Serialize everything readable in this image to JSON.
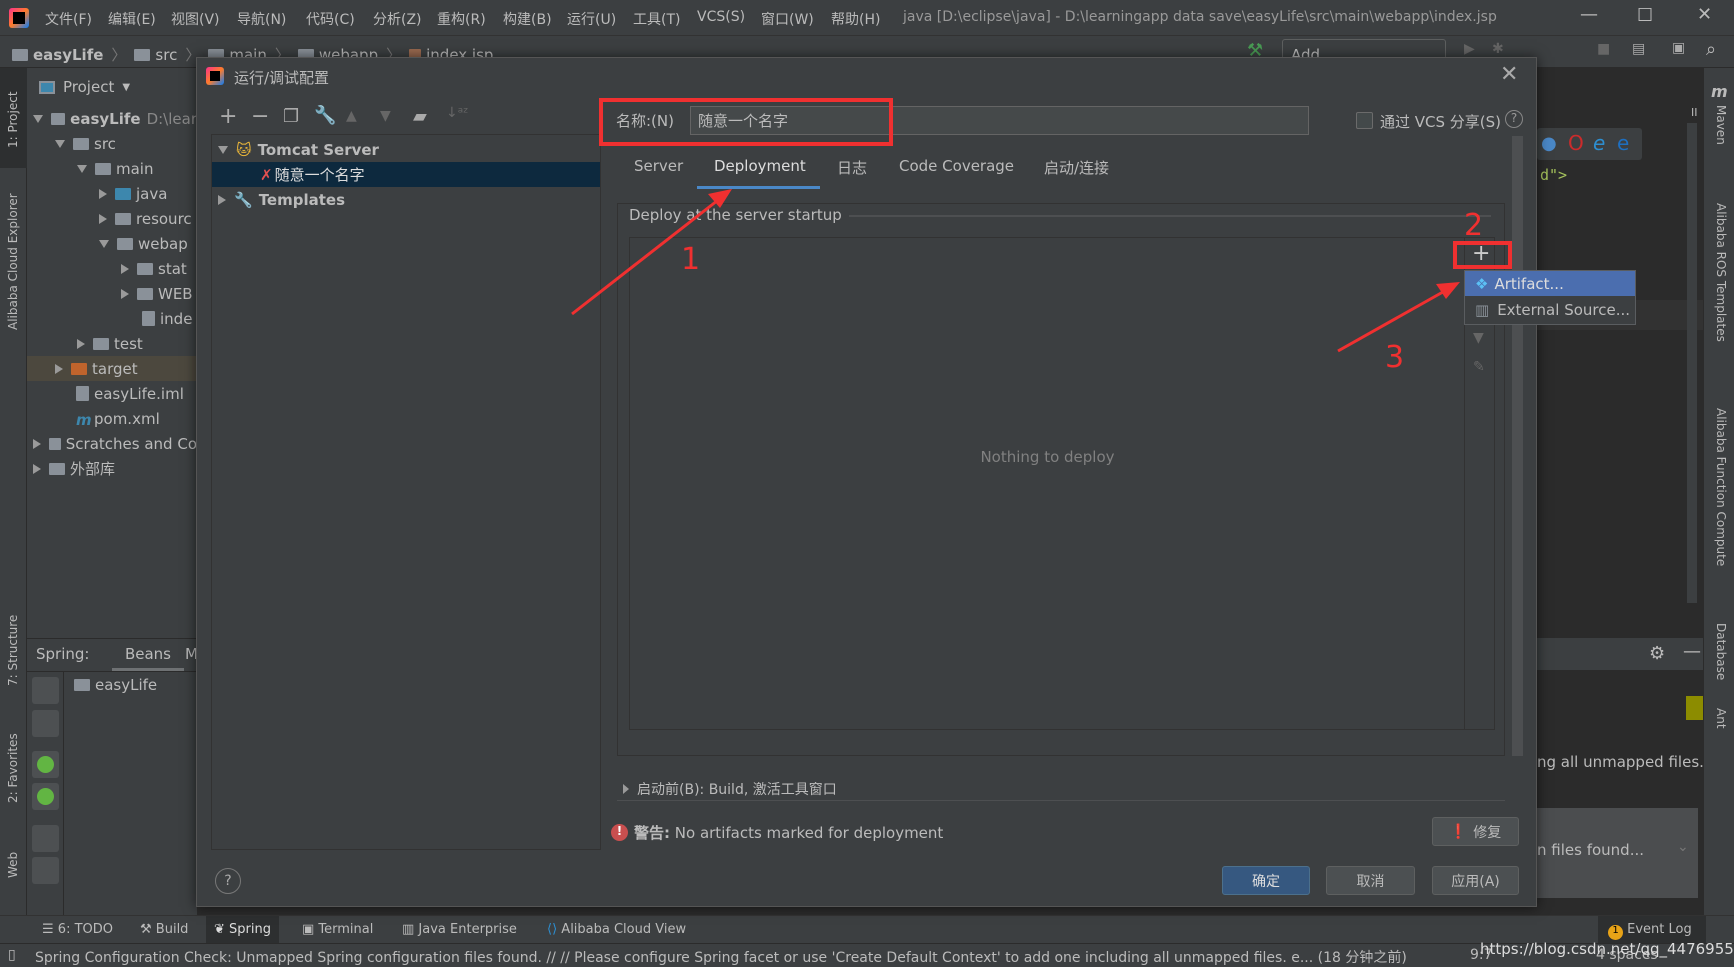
{
  "menubar": {
    "items": [
      "文件(F)",
      "编辑(E)",
      "视图(V)",
      "导航(N)",
      "代码(C)",
      "分析(Z)",
      "重构(R)",
      "构建(B)",
      "运行(U)",
      "工具(T)",
      "VCS(S)",
      "窗口(W)",
      "帮助(H)"
    ],
    "window_title": "java [D:\\eclipse\\java] - D:\\learningapp data save\\easyLife\\src\\main\\webapp\\index.jsp"
  },
  "breadcrumb": [
    "easyLife",
    "src",
    "main",
    "webapp",
    "index.jsp"
  ],
  "toolbar": {
    "add_configuration": "Add Configuration..."
  },
  "left_strip": {
    "project": "1: Project",
    "alibaba_explorer": "Alibaba Cloud Explorer",
    "structure": "7: Structure",
    "favorites": "2: Favorites",
    "web": "Web"
  },
  "project_panel": {
    "title": "Project",
    "tree": [
      {
        "label": "easyLife",
        "extra": "D:\\lear",
        "level": 0,
        "state": "open"
      },
      {
        "label": "src",
        "level": 1,
        "state": "open"
      },
      {
        "label": "main",
        "level": 2,
        "state": "open"
      },
      {
        "label": "java",
        "level": 3,
        "state": "closed"
      },
      {
        "label": "resourc",
        "level": 3,
        "state": "closed"
      },
      {
        "label": "webap",
        "level": 3,
        "state": "open"
      },
      {
        "label": "stat",
        "level": 4,
        "state": "closed"
      },
      {
        "label": "WEB",
        "level": 4,
        "state": "closed"
      },
      {
        "label": "inde",
        "level": 4,
        "state": "leaf"
      },
      {
        "label": "test",
        "level": 2,
        "state": "closed"
      },
      {
        "label": "target",
        "level": 1,
        "state": "closed"
      },
      {
        "label": "easyLife.iml",
        "level": 1,
        "state": "leaf"
      },
      {
        "label": "pom.xml",
        "level": 1,
        "state": "leaf"
      },
      {
        "label": "Scratches and Co",
        "level": 0,
        "state": "closed"
      },
      {
        "label": "外部库",
        "level": 0,
        "state": "closed"
      }
    ]
  },
  "spring_panel": {
    "label": "Spring:",
    "tab": "Beans",
    "tab2": "M",
    "item": "easyLife"
  },
  "dialog": {
    "title": "运行/调试配置",
    "tree": {
      "group": "Tomcat Server",
      "config": "随意一个名字",
      "templates": "Templates"
    },
    "name_label": "名称:(N)",
    "name_value": "随意一个名字",
    "vcs_label": "通过 VCS 分享(S)",
    "vcs_checked": false,
    "tabs": [
      "Server",
      "Deployment",
      "日志",
      "Code Coverage",
      "启动/连接"
    ],
    "active_tab": "Deployment",
    "deploy_label": "Deploy at the server startup",
    "empty_text": "Nothing to deploy",
    "popup": [
      "Artifact...",
      "External Source..."
    ],
    "before_launch": "启动前(B): Build, 激活工具窗口",
    "warning_label": "警告:",
    "warning_text": "No artifacts marked for deployment",
    "fix": "修复",
    "ok": "确定",
    "cancel": "取消",
    "apply": "应用(A)",
    "help": "?"
  },
  "annotations": {
    "n1": "1",
    "n2": "2",
    "n3": "3",
    "color": "#f03030"
  },
  "editor": {
    "code": "d\">",
    "notif1": "ng all unmapped files.",
    "notif2": "n files found..."
  },
  "right_strip": {
    "maven": "Maven",
    "ros": "Alibaba ROS Templates",
    "function": "Alibaba Function Compute",
    "database": "Database",
    "ant": "Ant"
  },
  "bottom_tools": [
    "6: TODO",
    "Build",
    "Spring",
    "Terminal",
    "Java Enterprise",
    "Alibaba Cloud View"
  ],
  "event_log": "Event Log",
  "event_count": "1",
  "status": {
    "message": "Spring Configuration Check: Unmapped Spring configuration files found. // // Please configure Spring facet or use 'Create Default Context' to add one including all unmapped files. e... (18 分钟之前)",
    "position": "9:7",
    "watermark": "https://blog.csdn.net/qq_44769557",
    "indent": "4 spaces"
  }
}
